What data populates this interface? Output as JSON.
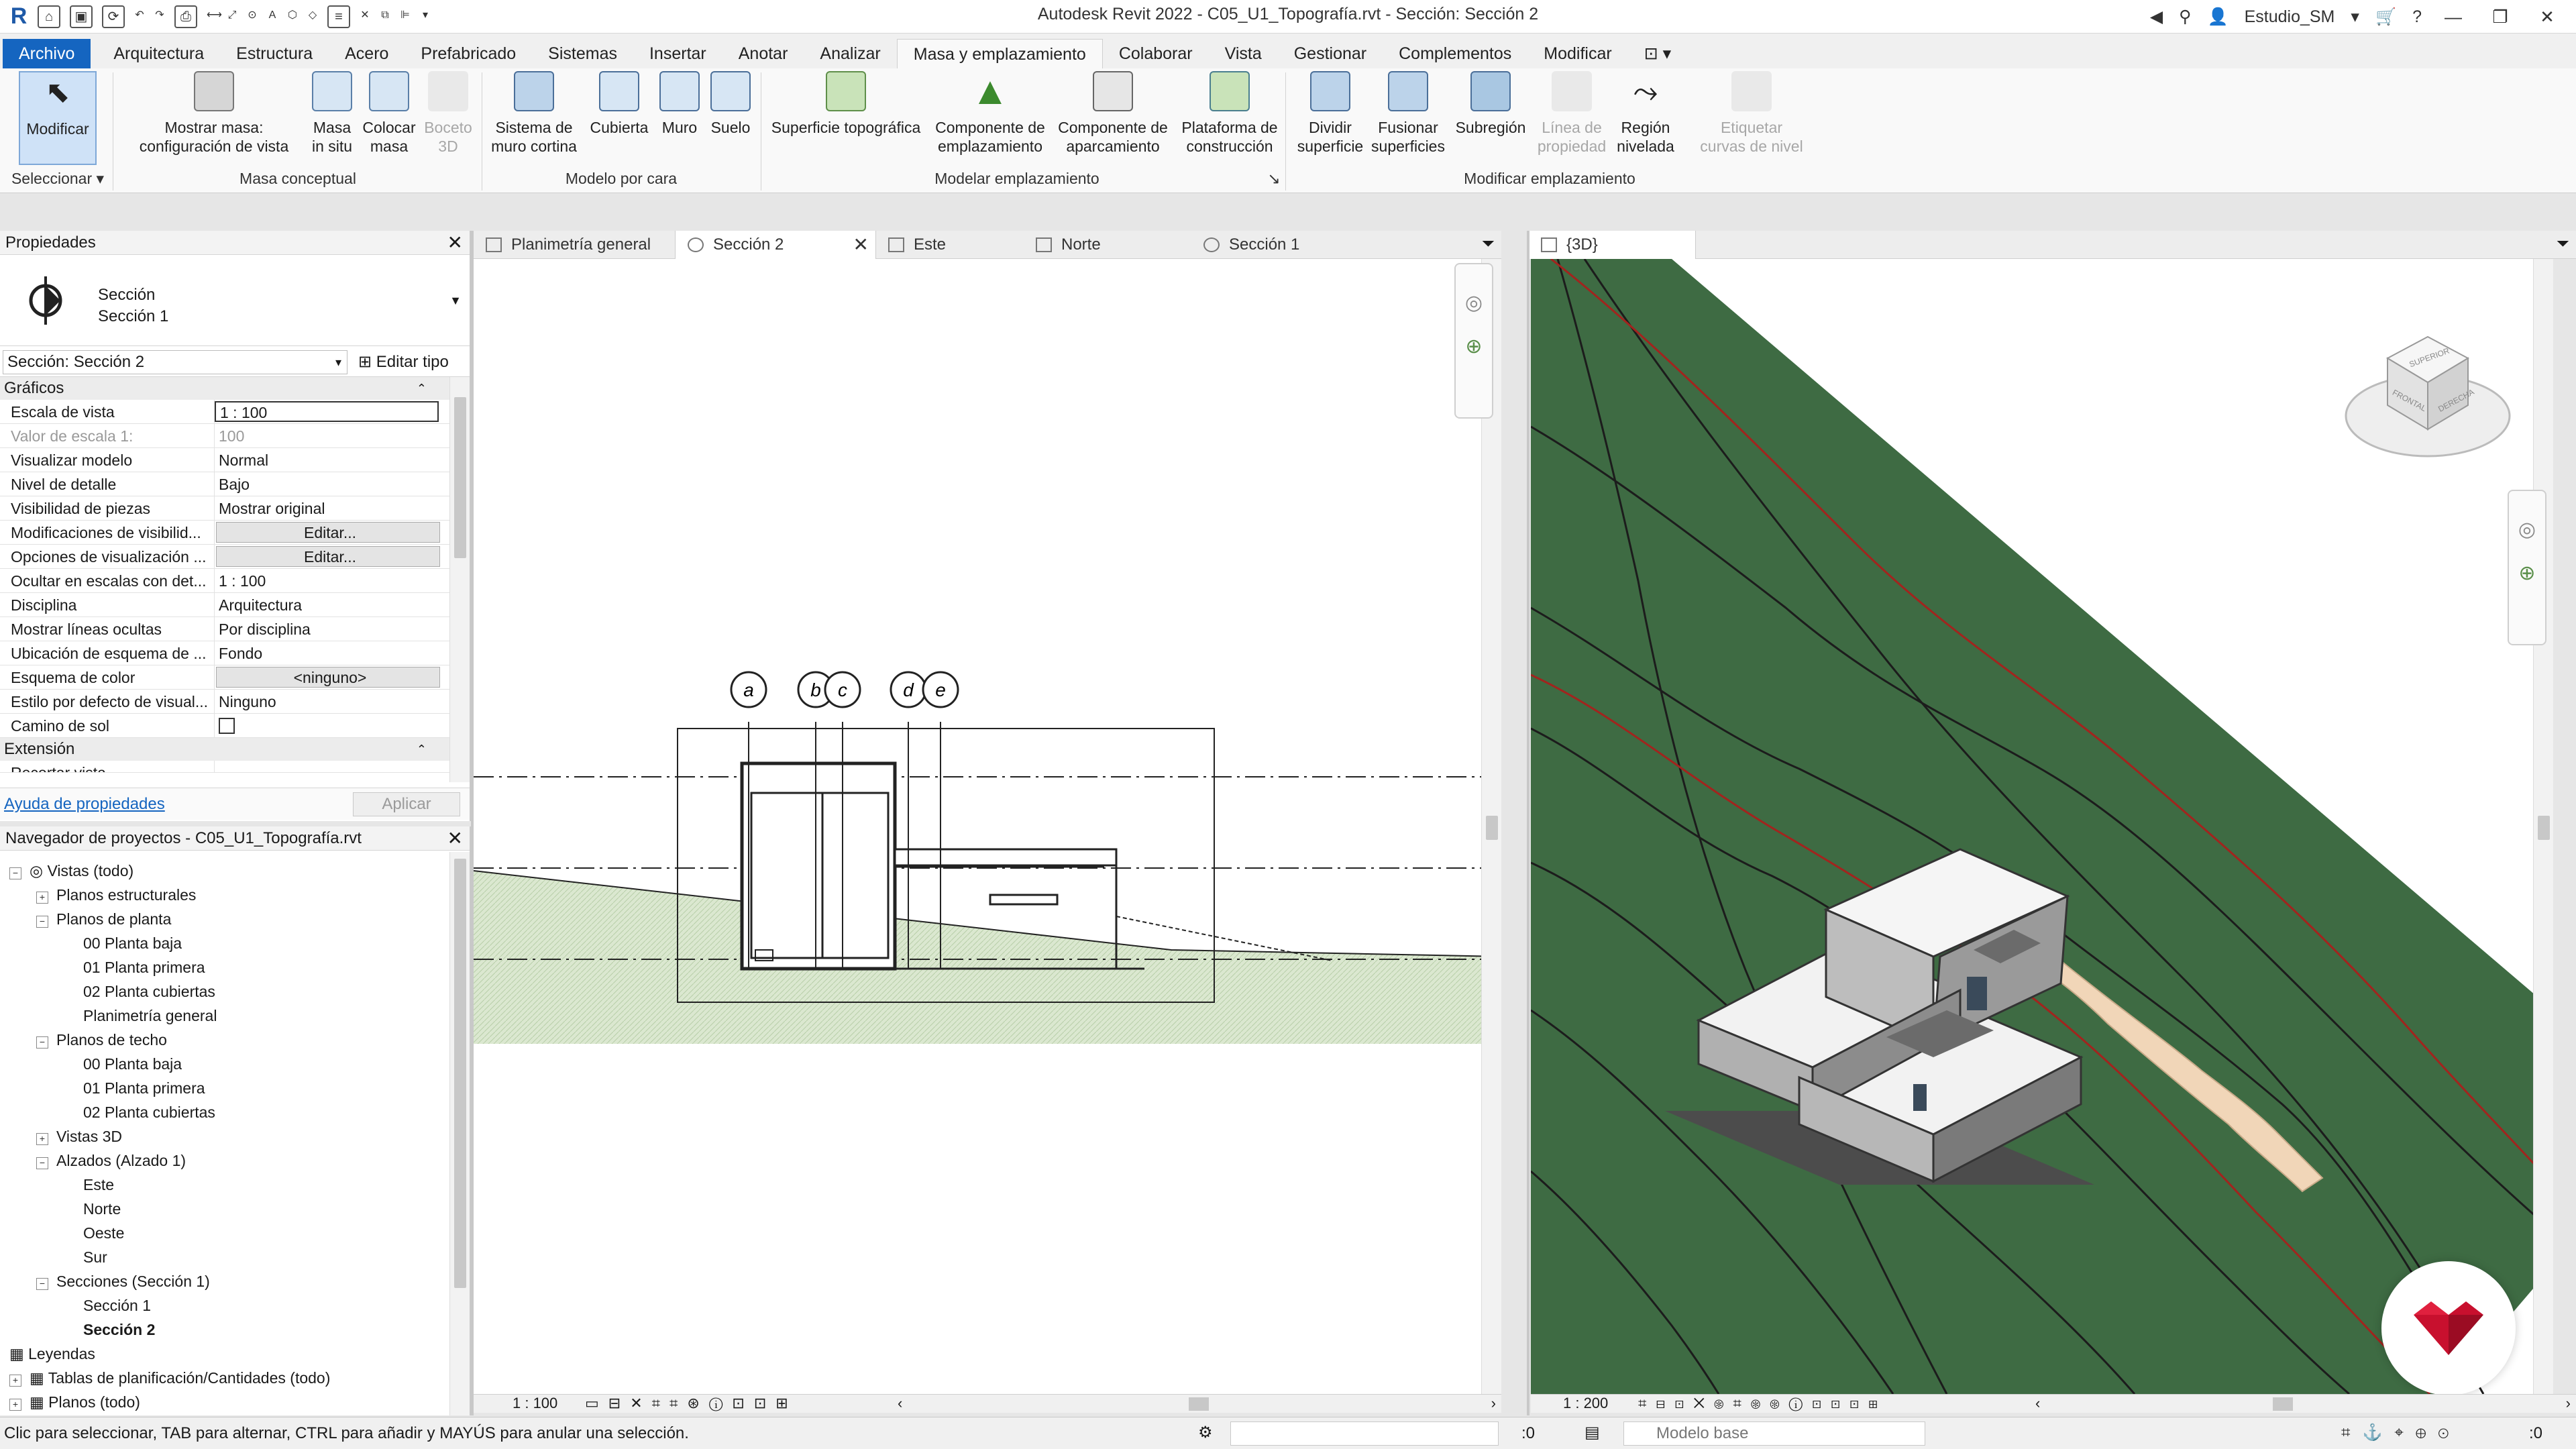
{
  "app": {
    "title": "Autodesk Revit 2022 - C05_U1_Topografía.rvt - Sección: Sección 2",
    "user": "Estudio_SM",
    "logo": "R"
  },
  "ribbon_tabs": [
    "Archivo",
    "Arquitectura",
    "Estructura",
    "Acero",
    "Prefabricado",
    "Sistemas",
    "Insertar",
    "Anotar",
    "Analizar",
    "Masa y emplazamiento",
    "Colaborar",
    "Vista",
    "Gestionar",
    "Complementos",
    "Modificar"
  ],
  "ribbon": {
    "select_label": "Seleccionar",
    "modify": "Modificar",
    "buttons": [
      {
        "label": "Mostrar masa:\nconfiguración de vista"
      },
      {
        "label": "Masa\nin situ"
      },
      {
        "label": "Colocar\nmasa"
      },
      {
        "label": "Boceto\n3D"
      },
      {
        "label": "Sistema de\nmuro cortina"
      },
      {
        "label": "Cubierta"
      },
      {
        "label": "Muro"
      },
      {
        "label": "Suelo"
      },
      {
        "label": "Superficie topográfica"
      },
      {
        "label": "Componente de\nemplazamiento"
      },
      {
        "label": "Componente de\naparcamiento"
      },
      {
        "label": "Plataforma de\nconstrucción"
      },
      {
        "label": "Dividir\nsuperficie"
      },
      {
        "label": "Fusionar\nsuperficies"
      },
      {
        "label": "Subregión"
      },
      {
        "label": "Línea de\npropiedad"
      },
      {
        "label": "Región\nnivelada"
      },
      {
        "label": "Etiquetar\ncurvas de nivel"
      }
    ],
    "panels": [
      "Masa conceptual",
      "Modelo por cara",
      "Modelar emplazamiento",
      "Modificar emplazamiento"
    ]
  },
  "properties": {
    "header": "Propiedades",
    "type_line1": "Sección",
    "type_line2": "Sección 1",
    "instance_combo": "Sección: Sección 2",
    "edit_type": "Editar tipo",
    "group_graphics": "Gráficos",
    "group_extent": "Extensión",
    "rows": [
      {
        "k": "Escala de vista",
        "v": "1 : 100"
      },
      {
        "k": "Valor de escala    1:",
        "v": "100"
      },
      {
        "k": "Visualizar modelo",
        "v": "Normal"
      },
      {
        "k": "Nivel de detalle",
        "v": "Bajo"
      },
      {
        "k": "Visibilidad de piezas",
        "v": "Mostrar original"
      },
      {
        "k": "Modificaciones de visibilid...",
        "v": "Editar..."
      },
      {
        "k": "Opciones de visualización ...",
        "v": "Editar..."
      },
      {
        "k": "Ocultar en escalas con det...",
        "v": "1 : 100"
      },
      {
        "k": "Disciplina",
        "v": "Arquitectura"
      },
      {
        "k": "Mostrar líneas ocultas",
        "v": "Por disciplina"
      },
      {
        "k": "Ubicación de esquema de ...",
        "v": "Fondo"
      },
      {
        "k": "Esquema de color",
        "v": "<ninguno>"
      },
      {
        "k": "Estilo por defecto de visual...",
        "v": "Ninguno"
      },
      {
        "k": "Camino de sol",
        "v": ""
      }
    ],
    "extent_row": "Recortar vista",
    "help": "Ayuda de propiedades",
    "apply": "Aplicar"
  },
  "browser": {
    "header": "Navegador de proyectos - C05_U1_Topografía.rvt",
    "nodes": [
      {
        "label": "Vistas (todo)"
      },
      {
        "label": "Planos estructurales"
      },
      {
        "label": "Planos de planta"
      },
      {
        "label": "00 Planta baja"
      },
      {
        "label": "01 Planta primera"
      },
      {
        "label": "02 Planta cubiertas"
      },
      {
        "label": "Planimetría general"
      },
      {
        "label": "Planos de techo"
      },
      {
        "label": "00 Planta baja"
      },
      {
        "label": "01 Planta primera"
      },
      {
        "label": "02 Planta cubiertas"
      },
      {
        "label": "Vistas 3D"
      },
      {
        "label": "Alzados (Alzado 1)"
      },
      {
        "label": "Este"
      },
      {
        "label": "Norte"
      },
      {
        "label": "Oeste"
      },
      {
        "label": "Sur"
      },
      {
        "label": "Secciones (Sección 1)"
      },
      {
        "label": "Sección 1"
      },
      {
        "label": "Sección 2"
      },
      {
        "label": "Leyendas"
      },
      {
        "label": "Tablas de planificación/Cantidades (todo)"
      },
      {
        "label": "Planos (todo)"
      }
    ]
  },
  "view_tabs": [
    "Planimetría general",
    "Sección 2",
    "Este",
    "Norte",
    "Sección 1"
  ],
  "view3d_tab": "{3D}",
  "section": {
    "grid_labels": [
      "a",
      "b",
      "c",
      "d",
      "e"
    ],
    "scale": "1 : 100"
  },
  "view3d": {
    "scale": "1 : 200",
    "cube_labels": [
      "SUPERIOR",
      "FRONTAL",
      "DERECHA"
    ]
  },
  "status": {
    "message": "Clic para seleccionar, TAB para alternar, CTRL para añadir y MAYÚS para anular una selección.",
    "zero": ":0",
    "model": "Modelo base",
    "filter": ":0"
  },
  "colors": {
    "terrain": "#3e6b43",
    "contour_red": "#a2241e",
    "ground_hatch": "#dbe8d0",
    "path": "#f1d6b8",
    "accent": "#1565c0",
    "brand": "#c8102e"
  }
}
